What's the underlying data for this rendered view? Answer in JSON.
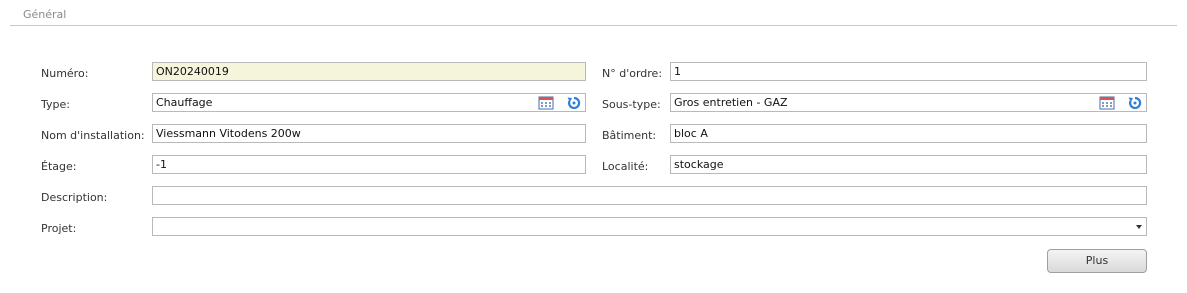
{
  "section": {
    "title": "Général"
  },
  "fields": {
    "numero": {
      "label": "Numéro:",
      "value": "ON20240019"
    },
    "ordre": {
      "label": "N° d'ordre:",
      "value": "1"
    },
    "type": {
      "label": "Type:",
      "value": "Chauffage"
    },
    "soustype": {
      "label": "Sous-type:",
      "value": "Gros entretien - GAZ"
    },
    "installation": {
      "label": "Nom d'installation:",
      "value": "Viessmann Vitodens 200w"
    },
    "batiment": {
      "label": "Bâtiment:",
      "value": "bloc A"
    },
    "etage": {
      "label": "Étage:",
      "value": "-1"
    },
    "localite": {
      "label": "Localité:",
      "value": "stockage"
    },
    "description": {
      "label": "Description:",
      "value": ""
    },
    "projet": {
      "label": "Projet:",
      "value": ""
    }
  },
  "buttons": {
    "plus": "Plus"
  },
  "icons": {
    "calendar": "calendar-icon",
    "reset": "reset-icon"
  },
  "colors": {
    "readonly_bg": "#f5f5dc",
    "icon_blue": "#2f7ed8"
  }
}
